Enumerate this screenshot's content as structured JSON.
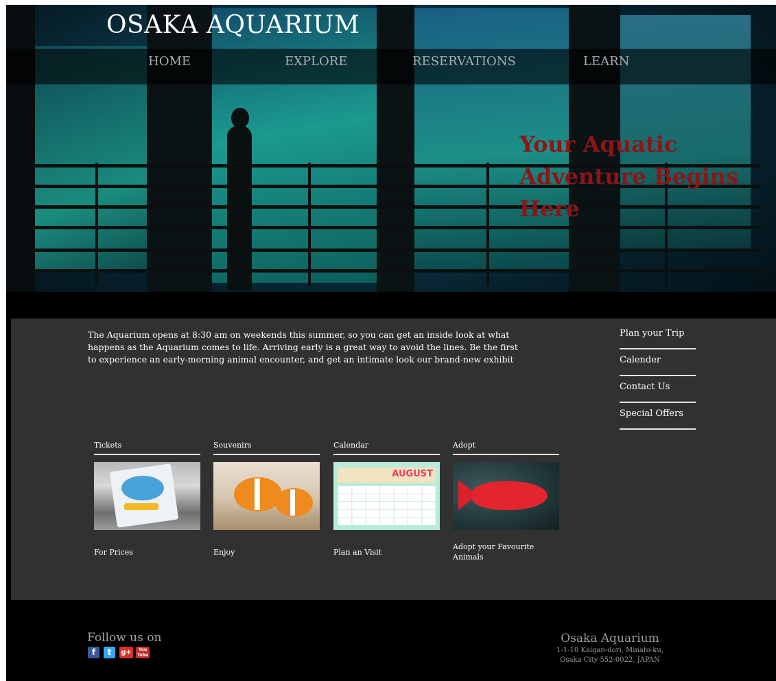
{
  "site": {
    "title": "OSAKA AQUARIUM",
    "tagline": "Your Aquatic Adventure Begins Here"
  },
  "nav": {
    "items": [
      {
        "label": "HOME"
      },
      {
        "label": "EXPLORE"
      },
      {
        "label": "RESERVATIONS"
      },
      {
        "label": "LEARN"
      }
    ]
  },
  "intro": {
    "text": "The Aquarium opens at 8:30 am on weekends this summer, so you can get an inside look at what happens as the Aquarium comes to life. Arriving early is a great way to avoid the lines. Be the first to experience an early-morning animal encounter, and get an intimate look our brand-new exhibit"
  },
  "sidebar": {
    "links": [
      {
        "label": "Plan your Trip"
      },
      {
        "label": "Calender"
      },
      {
        "label": "Contact Us"
      },
      {
        "label": "Special Offers"
      }
    ]
  },
  "cards": [
    {
      "title": "Tickets",
      "caption": "For Prices"
    },
    {
      "title": "Souvenirs",
      "caption": "Enjoy"
    },
    {
      "title": "Calendar",
      "caption": "Plan an Visit",
      "image_text": "AUGUST"
    },
    {
      "title": "Adopt",
      "caption": "Adopt your Favourite Animals"
    }
  ],
  "footer": {
    "follow_label": "Follow us on",
    "social": [
      {
        "icon": "facebook-icon",
        "glyph": "f",
        "color": "#3b5998"
      },
      {
        "icon": "twitter-icon",
        "glyph": "t",
        "color": "#33aaf0"
      },
      {
        "icon": "google-plus-icon",
        "glyph": "g+",
        "color": "#d9312b"
      },
      {
        "icon": "youtube-icon",
        "glyph": "You Tube",
        "color": "#c4302b"
      }
    ],
    "address": {
      "name": "Osaka Aquarium",
      "line1": "1-1-10 Kaigan-dori, Minato-ku,",
      "line2": "Osaka City 552-0022, JAPAN"
    }
  },
  "colors": {
    "tagline": "#8e1418",
    "content_bg": "#313131",
    "page_bg": "#000000"
  }
}
